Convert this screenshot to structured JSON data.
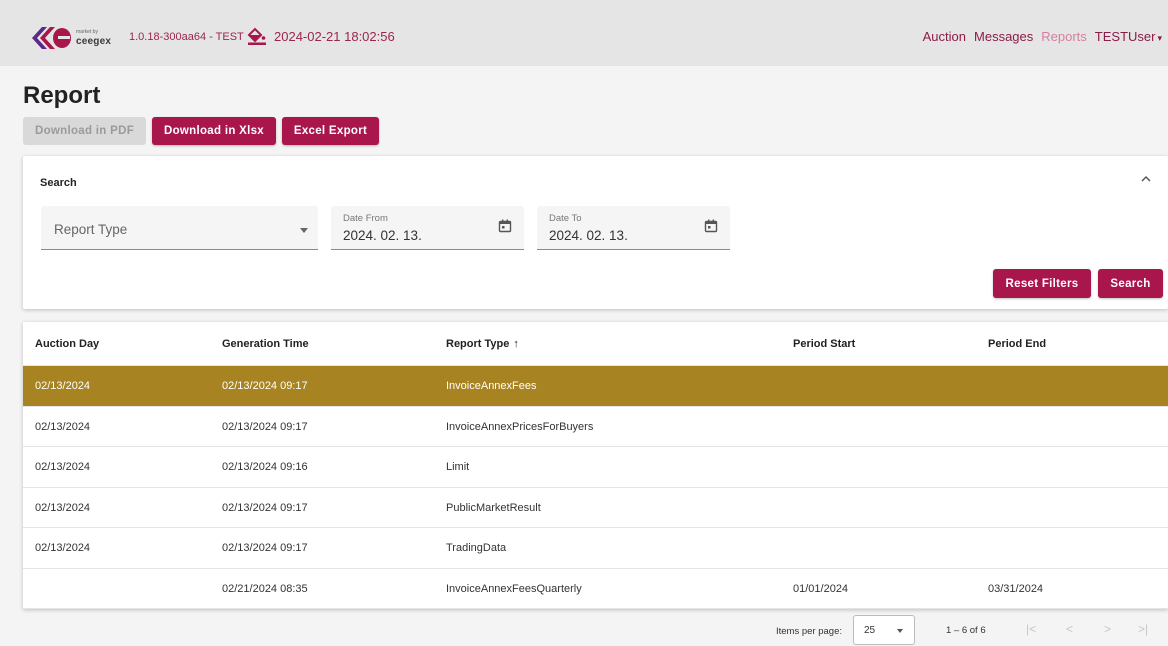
{
  "header": {
    "logo_small_text": "market by",
    "logo_brand": "ceegex",
    "version": "1.0.18-300aa64 - TEST",
    "datetime": "2024-02-21 18:02:56",
    "nav": [
      {
        "label": "Auction",
        "active": false
      },
      {
        "label": "Messages",
        "active": false
      },
      {
        "label": "Reports",
        "active": true
      },
      {
        "label": "TESTUser",
        "active": false
      }
    ],
    "user_caret": "▾"
  },
  "page": {
    "title": "Report"
  },
  "toolbar": {
    "download_pdf": "Download in PDF",
    "download_xlsx": "Download in Xlsx",
    "excel_export": "Excel Export"
  },
  "search": {
    "title": "Search",
    "report_type_placeholder": "Report Type",
    "date_from_label": "Date From",
    "date_from_value": "2024. 02. 13.",
    "date_to_label": "Date To",
    "date_to_value": "2024. 02. 13.",
    "reset_label": "Reset Filters",
    "search_label": "Search"
  },
  "colors": {
    "brand": "#a9164c",
    "selected_row": "#a88322",
    "nav_active": "#d97ea1"
  },
  "table": {
    "columns": [
      "Auction Day",
      "Generation Time",
      "Report Type",
      "Period Start",
      "Period End"
    ],
    "sort_indicator": "↑",
    "rows": [
      {
        "auction_day": "02/13/2024",
        "generation_time": "02/13/2024 09:17",
        "report_type": "InvoiceAnnexFees",
        "period_start": "",
        "period_end": "",
        "selected": true
      },
      {
        "auction_day": "02/13/2024",
        "generation_time": "02/13/2024 09:17",
        "report_type": "InvoiceAnnexPricesForBuyers",
        "period_start": "",
        "period_end": "",
        "selected": false
      },
      {
        "auction_day": "02/13/2024",
        "generation_time": "02/13/2024 09:16",
        "report_type": "Limit",
        "period_start": "",
        "period_end": "",
        "selected": false
      },
      {
        "auction_day": "02/13/2024",
        "generation_time": "02/13/2024 09:17",
        "report_type": "PublicMarketResult",
        "period_start": "",
        "period_end": "",
        "selected": false
      },
      {
        "auction_day": "02/13/2024",
        "generation_time": "02/13/2024 09:17",
        "report_type": "TradingData",
        "period_start": "",
        "period_end": "",
        "selected": false
      },
      {
        "auction_day": "",
        "generation_time": "02/21/2024 08:35",
        "report_type": "InvoiceAnnexFeesQuarterly",
        "period_start": "01/01/2024",
        "period_end": "03/31/2024",
        "selected": false
      }
    ]
  },
  "paginator": {
    "items_per_page_label": "Items per page:",
    "page_size": "25",
    "range": "1 – 6 of 6",
    "first": "|<",
    "prev": "<",
    "next": ">",
    "last": ">|"
  }
}
